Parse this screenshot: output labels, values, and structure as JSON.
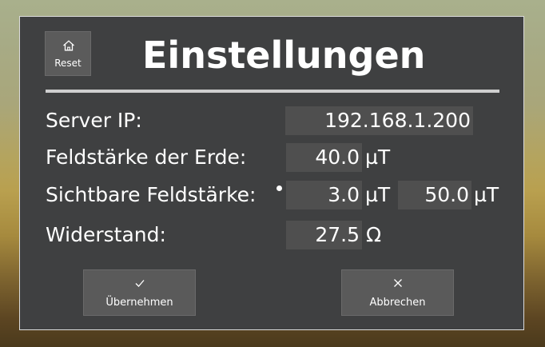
{
  "dialog": {
    "title": "Einstellungen",
    "reset": {
      "label": "Reset",
      "icon": "home-icon"
    },
    "fields": {
      "server_ip": {
        "label": "Server IP:",
        "value": "192.168.1.200"
      },
      "earth_field": {
        "label": "Feldstärke der Erde:",
        "value": "40.0",
        "unit": "µT"
      },
      "visible_field": {
        "label": "Sichtbare Feldstärke:",
        "min_value": "3.0",
        "min_unit": "µT",
        "max_value": "50.0",
        "max_unit": "µT"
      },
      "resistance": {
        "label": "Widerstand:",
        "value": "27.5",
        "unit": "Ω"
      }
    },
    "buttons": {
      "apply": {
        "label": "Übernehmen",
        "icon": "checkmark-icon"
      },
      "cancel": {
        "label": "Abbrechen",
        "icon": "close-icon"
      }
    }
  },
  "colors": {
    "dialog_bg": "#3f4041",
    "field_bg": "#4f4f4f",
    "button_bg": "#5a5a5a",
    "text": "#ffffff"
  }
}
